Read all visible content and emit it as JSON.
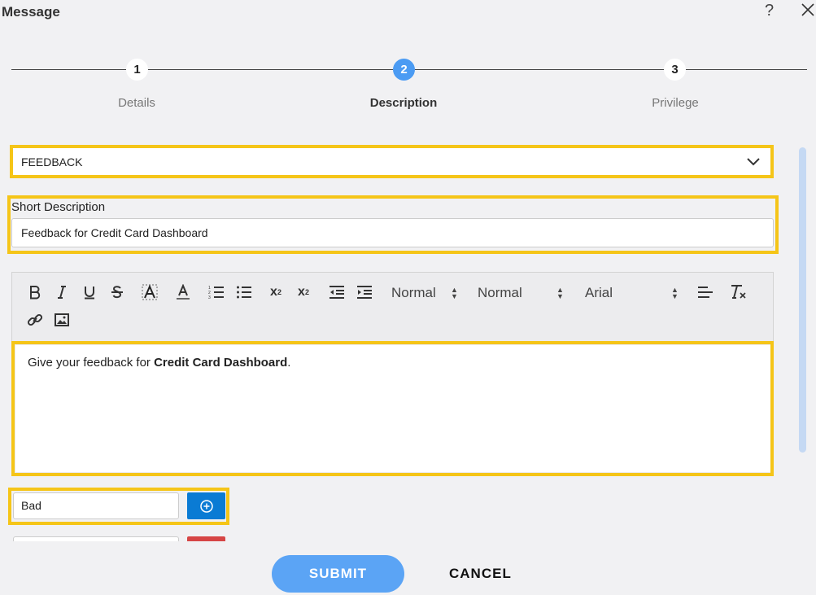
{
  "dialog": {
    "title": "Message",
    "help_label": "?"
  },
  "steps": [
    {
      "number": "1",
      "label": "Details"
    },
    {
      "number": "2",
      "label": "Description"
    },
    {
      "number": "3",
      "label": "Privilege"
    }
  ],
  "form": {
    "type_select_value": "FEEDBACK",
    "short_description_label": "Short Description",
    "short_description_value": "Feedback for Credit Card Dashboard",
    "toolbar": {
      "size_picker": "Normal",
      "header_picker": "Normal",
      "font_picker": "Arial",
      "subscript_base": "x",
      "subscript_mark": "2",
      "superscript_base": "x",
      "superscript_mark": "2"
    },
    "editor": {
      "text_prefix": "Give your feedback for ",
      "text_bold": "Credit Card Dashboard",
      "text_suffix": "."
    },
    "option_value": "Bad"
  },
  "actions": {
    "submit_label": "SUBMIT",
    "cancel_label": "CANCEL"
  },
  "colors": {
    "accent": "#4b9bf3",
    "highlight": "#f5c518",
    "add_button": "#0a7bd4",
    "delete_button": "#d64545"
  }
}
